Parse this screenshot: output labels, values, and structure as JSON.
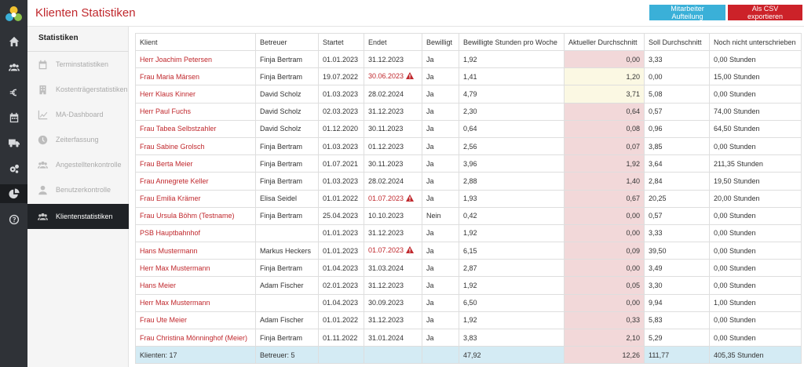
{
  "header": {
    "title": "Klienten Statistiken",
    "btn_mitarbeiter": "Mitarbeiter Aufteilung",
    "btn_csv": "Als CSV exportieren"
  },
  "colors": {
    "accent_red": "#c0282d",
    "button_blue": "#3ab0d8",
    "button_red": "#cc2229",
    "rail": "#2f3237"
  },
  "rail_icons": [
    "home-icon",
    "users-icon",
    "euro-icon",
    "calendar-icon",
    "truck-icon",
    "cogs-icon",
    "pie-chart-icon",
    "help-icon"
  ],
  "subnav": {
    "title": "Statistiken",
    "items": [
      {
        "label": "Terminstatistiken",
        "icon": "calendar-icon"
      },
      {
        "label": "Kostenträgerstatistiken",
        "icon": "building-icon"
      },
      {
        "label": "MA-Dashboard",
        "icon": "line-chart-icon"
      },
      {
        "label": "Zeiterfassung",
        "icon": "clock-icon"
      },
      {
        "label": "Angestelltenkontrolle",
        "icon": "users-icon"
      },
      {
        "label": "Benutzerkontrolle",
        "icon": "user-icon"
      },
      {
        "label": "Klientenstatistiken",
        "icon": "users-icon",
        "active": true
      }
    ]
  },
  "table": {
    "headers": [
      "Klient",
      "Betreuer",
      "Startet",
      "Endet",
      "Bewilligt",
      "Bewilligte Stunden pro Woche",
      "Aktueller Durchschnitt",
      "Soll Durchschnitt",
      "Noch nicht unterschrieben"
    ],
    "rows": [
      {
        "klient": "Herr Joachim Petersen",
        "betreuer": "Finja Bertram",
        "startet": "01.01.2023",
        "endet": "31.12.2023",
        "endet_warn": false,
        "bewilligt": "Ja",
        "stunden": "1,92",
        "aktuell": "0,00",
        "aktuell_bg": "pink",
        "soll": "3,33",
        "offen": "0,00 Stunden"
      },
      {
        "klient": "Frau Maria Märsen",
        "betreuer": "Finja Bertram",
        "startet": "19.07.2022",
        "endet": "30.06.2023",
        "endet_warn": true,
        "bewilligt": "Ja",
        "stunden": "1,41",
        "aktuell": "1,20",
        "aktuell_bg": "yellow",
        "soll": "0,00",
        "offen": "15,00 Stunden"
      },
      {
        "klient": "Herr Klaus Kinner",
        "betreuer": "David Scholz",
        "startet": "01.03.2023",
        "endet": "28.02.2024",
        "endet_warn": false,
        "bewilligt": "Ja",
        "stunden": "4,79",
        "aktuell": "3,71",
        "aktuell_bg": "yellow",
        "soll": "5,08",
        "offen": "0,00 Stunden"
      },
      {
        "klient": "Herr Paul Fuchs",
        "betreuer": "David Scholz",
        "startet": "02.03.2023",
        "endet": "31.12.2023",
        "endet_warn": false,
        "bewilligt": "Ja",
        "stunden": "2,30",
        "aktuell": "0,64",
        "aktuell_bg": "pink",
        "soll": "0,57",
        "offen": "74,00 Stunden"
      },
      {
        "klient": "Frau Tabea Selbstzahler",
        "betreuer": "David Scholz",
        "startet": "01.12.2020",
        "endet": "30.11.2023",
        "endet_warn": false,
        "bewilligt": "Ja",
        "stunden": "0,64",
        "aktuell": "0,08",
        "aktuell_bg": "pink",
        "soll": "0,96",
        "offen": "64,50 Stunden"
      },
      {
        "klient": "Frau Sabine Grolsch",
        "betreuer": "Finja Bertram",
        "startet": "01.03.2023",
        "endet": "01.12.2023",
        "endet_warn": false,
        "bewilligt": "Ja",
        "stunden": "2,56",
        "aktuell": "0,07",
        "aktuell_bg": "pink",
        "soll": "3,85",
        "offen": "0,00 Stunden"
      },
      {
        "klient": "Frau Berta Meier",
        "betreuer": "Finja Bertram",
        "startet": "01.07.2021",
        "endet": "30.11.2023",
        "endet_warn": false,
        "bewilligt": "Ja",
        "stunden": "3,96",
        "aktuell": "1,92",
        "aktuell_bg": "pink",
        "soll": "3,64",
        "offen": "211,35 Stunden"
      },
      {
        "klient": "Frau Annegrete Keller",
        "betreuer": "Finja Bertram",
        "startet": "01.03.2023",
        "endet": "28.02.2024",
        "endet_warn": false,
        "bewilligt": "Ja",
        "stunden": "2,88",
        "aktuell": "1,40",
        "aktuell_bg": "pink",
        "soll": "2,84",
        "offen": "19,50 Stunden"
      },
      {
        "klient": "Frau Emilia Krämer",
        "betreuer": "Elisa Seidel",
        "startet": "01.01.2022",
        "endet": "01.07.2023",
        "endet_warn": true,
        "bewilligt": "Ja",
        "stunden": "1,93",
        "aktuell": "0,67",
        "aktuell_bg": "pink",
        "soll": "20,25",
        "offen": "20,00 Stunden"
      },
      {
        "klient": "Frau Ursula Böhm (Testname)",
        "betreuer": "Finja Bertram",
        "startet": "25.04.2023",
        "endet": "10.10.2023",
        "endet_warn": false,
        "bewilligt": "Nein",
        "stunden": "0,42",
        "aktuell": "0,00",
        "aktuell_bg": "pink",
        "soll": "0,57",
        "offen": "0,00 Stunden"
      },
      {
        "klient": "PSB Hauptbahnhof",
        "betreuer": "",
        "startet": "01.01.2023",
        "endet": "31.12.2023",
        "endet_warn": false,
        "bewilligt": "Ja",
        "stunden": "1,92",
        "aktuell": "0,00",
        "aktuell_bg": "pink",
        "soll": "3,33",
        "offen": "0,00 Stunden"
      },
      {
        "klient": "Hans Mustermann",
        "betreuer": "Markus Heckers",
        "startet": "01.01.2023",
        "endet": "01.07.2023",
        "endet_warn": true,
        "bewilligt": "Ja",
        "stunden": "6,15",
        "aktuell": "0,09",
        "aktuell_bg": "pink",
        "soll": "39,50",
        "offen": "0,00 Stunden"
      },
      {
        "klient": "Herr Max Mustermann",
        "betreuer": "Finja Bertram",
        "startet": "01.04.2023",
        "endet": "31.03.2024",
        "endet_warn": false,
        "bewilligt": "Ja",
        "stunden": "2,87",
        "aktuell": "0,00",
        "aktuell_bg": "pink",
        "soll": "3,49",
        "offen": "0,00 Stunden"
      },
      {
        "klient": "Hans Meier",
        "betreuer": "Adam Fischer",
        "startet": "02.01.2023",
        "endet": "31.12.2023",
        "endet_warn": false,
        "bewilligt": "Ja",
        "stunden": "1,92",
        "aktuell": "0,05",
        "aktuell_bg": "pink",
        "soll": "3,30",
        "offen": "0,00 Stunden"
      },
      {
        "klient": "Herr Max Mustermann",
        "betreuer": "",
        "startet": "01.04.2023",
        "endet": "30.09.2023",
        "endet_warn": false,
        "bewilligt": "Ja",
        "stunden": "6,50",
        "aktuell": "0,00",
        "aktuell_bg": "pink",
        "soll": "9,94",
        "offen": "1,00 Stunden"
      },
      {
        "klient": "Frau Ute Meier",
        "betreuer": "Adam Fischer",
        "startet": "01.01.2022",
        "endet": "31.12.2023",
        "endet_warn": false,
        "bewilligt": "Ja",
        "stunden": "1,92",
        "aktuell": "0,33",
        "aktuell_bg": "pink",
        "soll": "5,83",
        "offen": "0,00 Stunden"
      },
      {
        "klient": "Frau Christina Mönninghof (Meier)",
        "betreuer": "Finja Bertram",
        "startet": "01.11.2022",
        "endet": "31.01.2024",
        "endet_warn": false,
        "bewilligt": "Ja",
        "stunden": "3,83",
        "aktuell": "2,10",
        "aktuell_bg": "pink",
        "soll": "5,29",
        "offen": "0,00 Stunden"
      }
    ],
    "summary": {
      "klient": "Klienten: 17",
      "betreuer": "Betreuer: 5",
      "startet": "",
      "endet": "",
      "bewilligt": "",
      "stunden": "47,92",
      "aktuell": "12,26",
      "soll": "111,77",
      "offen": "405,35 Stunden"
    }
  }
}
